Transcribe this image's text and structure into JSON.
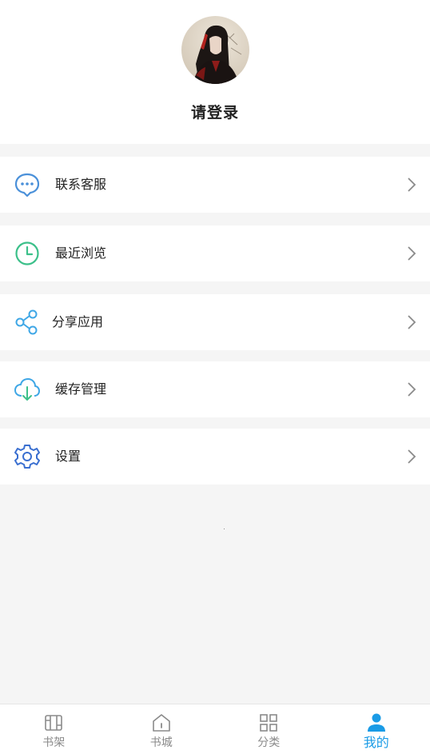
{
  "profile": {
    "login_label": "请登录"
  },
  "menu": {
    "items": [
      {
        "id": "customer-service",
        "label": "联系客服",
        "icon": "chat-bubble-icon"
      },
      {
        "id": "recent-browse",
        "label": "最近浏览",
        "icon": "clock-icon"
      },
      {
        "id": "share-app",
        "label": "分享应用",
        "icon": "share-icon"
      },
      {
        "id": "cache-manage",
        "label": "缓存管理",
        "icon": "cloud-download-icon"
      },
      {
        "id": "settings",
        "label": "设置",
        "icon": "gear-icon"
      }
    ]
  },
  "tabbar": {
    "tabs": [
      {
        "label": "书架",
        "icon": "bookshelf-icon",
        "active": false
      },
      {
        "label": "书城",
        "icon": "home-icon",
        "active": false
      },
      {
        "label": "分类",
        "icon": "grid-icon",
        "active": false
      },
      {
        "label": "我的",
        "icon": "user-icon",
        "active": true
      }
    ]
  },
  "colors": {
    "accent": "#1a9be6",
    "chat_icon": "#4a90d9",
    "clock_icon": "#3cc08a",
    "share_icon": "#3fa7e6",
    "cloud_icon": "#3fa7e6",
    "gear_icon": "#3a6fd0",
    "inactive_tab": "#8a8a8a",
    "background": "#f5f5f5"
  }
}
